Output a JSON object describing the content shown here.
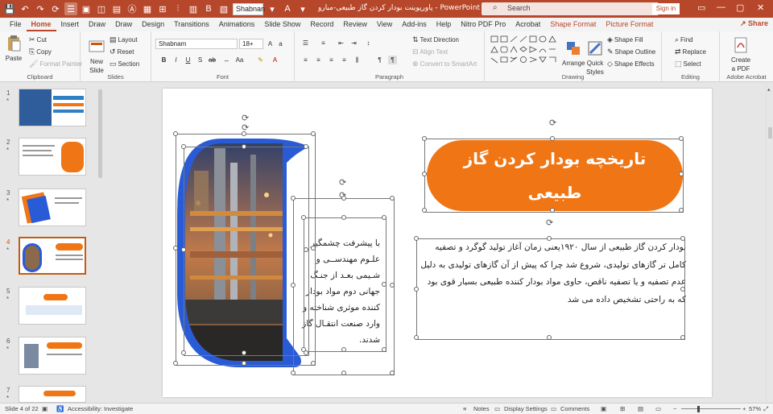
{
  "titlebar": {
    "font_name": "Shabnan",
    "doc_title": "پاورپوینت بودار کردن گاز طبیعی-مبارو - PowerPoint",
    "search_placeholder": "Search",
    "signin_label": "Sign in"
  },
  "menu": {
    "tabs": [
      "File",
      "Home",
      "Insert",
      "Draw",
      "Draw",
      "Design",
      "Transitions",
      "Animations",
      "Slide Show",
      "Record",
      "Review",
      "View",
      "Add-ins",
      "Help",
      "Nitro PDF Pro",
      "Acrobat",
      "Shape Format",
      "Picture Format"
    ],
    "active": "Home",
    "share_label": "Share"
  },
  "ribbon": {
    "clipboard": {
      "paste": "Paste",
      "cut": "Cut",
      "copy": "Copy",
      "format_painter": "Format Painter",
      "label": "Clipboard"
    },
    "slides": {
      "new_slide": "New",
      "new_slide2": "Slide",
      "layout": "Layout",
      "reset": "Reset",
      "section": "Section",
      "label": "Slides"
    },
    "font": {
      "font_name": "Shabnam",
      "font_size": "18+",
      "label": "Font"
    },
    "paragraph": {
      "text_direction": "Text Direction",
      "align_text": "Align Text",
      "convert_smartart": "Convert to SmartArt",
      "label": "Paragraph"
    },
    "drawing": {
      "arrange": "Arrange",
      "quick_styles": "Quick",
      "quick_styles2": "Styles",
      "shape_fill": "Shape Fill",
      "shape_outline": "Shape Outline",
      "shape_effects": "Shape Effects",
      "label": "Drawing"
    },
    "editing": {
      "find": "Find",
      "replace": "Replace",
      "select": "Select",
      "label": "Editing"
    },
    "adobe": {
      "create_pdf": "Create",
      "create_pdf2": "a PDF",
      "label": "Adobe Acrobat"
    }
  },
  "thumbnails": [
    {
      "num": "1",
      "star": "*"
    },
    {
      "num": "2",
      "star": "*"
    },
    {
      "num": "3",
      "star": "*"
    },
    {
      "num": "4",
      "star": "*"
    },
    {
      "num": "5",
      "star": "*"
    },
    {
      "num": "6",
      "star": "*"
    },
    {
      "num": "7",
      "star": "*"
    }
  ],
  "slide": {
    "title": "تاریخچه بودار کردن گاز طبیعی",
    "body_right": "بودار کردن گاز طبیعی از سال ۱۹۲۰یعنی زمان آغاز تولید گوگرد و تصفیه کامل تر گازهای تولیدی، شروع شد چرا که پیش از آن گازهای تولیدی به دلیل عدم تصفیه و یا تصفیه ناقص، حاوی مواد بودار کننده طبیعی بسیار قوی بود که به راحتی تشخیص داده می شد",
    "body_left": "با پیشرفت چشمگیر علـوم مهندســی و شـیمی بعـد از جنـگ جهانی دوم مواد بودار کننده موثری شناخته و وارد صنعت انتقـال گاز شدند.",
    "title_color": "#f07514",
    "frame_color": "#2a5bd7"
  },
  "status": {
    "slide_of": "Slide 4 of 22",
    "accessibility": "Accessibility: Investigate",
    "notes": "Notes",
    "display_settings": "Display Settings",
    "comments": "Comments",
    "zoom": "57%"
  }
}
